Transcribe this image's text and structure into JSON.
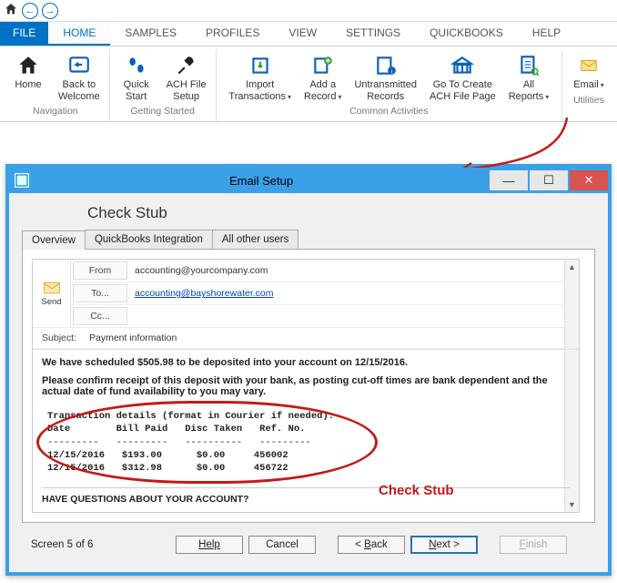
{
  "ribbon": {
    "file_tab": "FILE",
    "tabs": [
      "HOME",
      "SAMPLES",
      "PROFILES",
      "VIEW",
      "SETTINGS",
      "QUICKBOOKS",
      "HELP"
    ],
    "active_tab": "HOME",
    "groups": {
      "navigation": {
        "label": "Navigation",
        "items": {
          "home": "Home",
          "back": "Back to\nWelcome"
        }
      },
      "getting_started": {
        "label": "Getting Started",
        "items": {
          "quick": "Quick\nStart",
          "ach": "ACH File\nSetup"
        }
      },
      "common": {
        "label": "Common Activities",
        "items": {
          "import": "Import\nTransactions",
          "add": "Add a\nRecord",
          "untrans": "Untransmitted\nRecords",
          "goto": "Go To Create\nACH File Page",
          "reports": "All\nReports"
        }
      },
      "utilities": {
        "label": "Utilities",
        "items": {
          "email": "Email"
        }
      }
    }
  },
  "window": {
    "title": "Email Setup",
    "heading": "Check Stub",
    "tabs": [
      "Overview",
      "QuickBooks Integration",
      "All other users"
    ],
    "active_tab": "Overview"
  },
  "email": {
    "send": "Send",
    "labels": {
      "from": "From",
      "to": "To...",
      "cc": "Cc...",
      "subject": "Subject:"
    },
    "from": "accounting@yourcompany.com",
    "to": "accounting@bayshorewater.com",
    "cc": "",
    "subject": "Payment information",
    "body_line1": "We have scheduled $505.98 to be deposited into your account on 12/15/2016.",
    "body_line2": "Please confirm receipt of this deposit with your bank, as posting cut-off times are bank dependent and the actual date of fund availability to you may vary.",
    "stub_header": "Transaction details (format in Courier if needed):",
    "stub_cols": "Date        Bill Paid   Disc Taken   Ref. No.",
    "stub_sep": "---------   ---------   ----------   ---------",
    "stub_rows": [
      "12/15/2016   $193.00      $0.00     456002",
      "12/15/2016   $312.98      $0.00     456722"
    ],
    "callout": "Check Stub",
    "question": "HAVE QUESTIONS ABOUT YOUR ACCOUNT?"
  },
  "nav": {
    "screen": "Screen 5 of 6",
    "help": "Help",
    "cancel": "Cancel",
    "back_u": "B",
    "back_rest": "ack",
    "next_u": "N",
    "next_rest": "ext >",
    "back_prefix": "< ",
    "finish_u": "F",
    "finish_rest": "inish"
  },
  "colors": {
    "accent": "#0072c6",
    "window_frame": "#3aa0e8",
    "highlight_red": "#c21b17"
  }
}
